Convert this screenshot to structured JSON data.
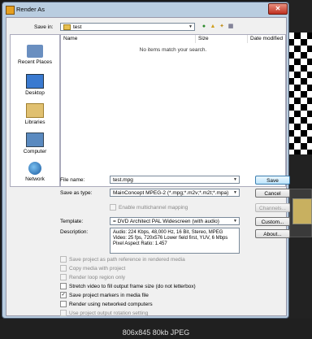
{
  "window": {
    "title": "Render As",
    "close_glyph": "✕"
  },
  "save_in": {
    "label": "Save in:",
    "value": "test"
  },
  "places": [
    {
      "label": "Recent Places",
      "icon": "recent-places-icon"
    },
    {
      "label": "Desktop",
      "icon": "desktop-icon"
    },
    {
      "label": "Libraries",
      "icon": "libraries-icon"
    },
    {
      "label": "Computer",
      "icon": "computer-icon"
    },
    {
      "label": "Network",
      "icon": "network-icon"
    }
  ],
  "file_list": {
    "columns": [
      "Name",
      "Size",
      "Date modified"
    ],
    "empty_message": "No items match your search."
  },
  "form": {
    "file_name_label": "File name:",
    "file_name_value": "test.mpg",
    "save_as_type_label": "Save as type:",
    "save_as_type_value": "MainConcept MPEG-2 (*.mpg;*.m2v;*.m2t;*.mpa)",
    "multichannel_label": "Enable multichannel mapping",
    "template_label": "Template:",
    "template_value": "= DVD Architect PAL Widescreen (with audio)",
    "description_label": "Description:",
    "description_value": "Audio: 224 Kbps, 48,000 Hz, 16 Bit, Stereo, MPEG\nVideo: 25 fps, 720x576 Lower field first, YUV, 6 Mbps\nPixel Aspect Ratio: 1.457"
  },
  "buttons": {
    "save": "Save",
    "cancel": "Cancel",
    "channels": "Channels...",
    "custom": "Custom...",
    "about": "About..."
  },
  "options": [
    {
      "label": "Save project as path reference in rendered media",
      "checked": false,
      "enabled": false
    },
    {
      "label": "Copy media with project",
      "checked": false,
      "enabled": false
    },
    {
      "label": "Render loop region only",
      "checked": false,
      "enabled": false
    },
    {
      "label": "Stretch video to fill output frame size (do not letterbox)",
      "checked": false,
      "enabled": true
    },
    {
      "label": "Save project markers in media file",
      "checked": true,
      "enabled": true
    },
    {
      "label": "Render using networked computers",
      "checked": false,
      "enabled": true
    },
    {
      "label": "Use project output rotation setting",
      "checked": false,
      "enabled": false
    }
  ],
  "image_caption": "806x845 80kb JPEG"
}
